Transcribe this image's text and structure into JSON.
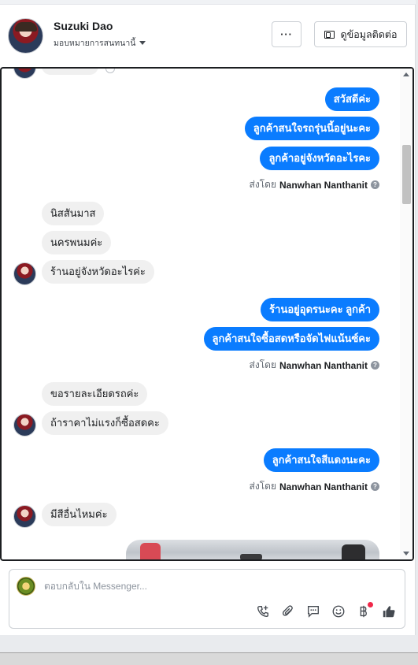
{
  "header": {
    "name": "Suzuki Dao",
    "assign_label": "มอบหมายการสนทนานี้",
    "more_label": "···",
    "contact_label": "ดูข้อมูลติดต่อ"
  },
  "messages": {
    "out1": [
      "สวัสดีค่ะ",
      "ลูกค้าสนใจรถรุ่นนี้อยู่นะคะ",
      "ลูกค้าอยู่จังหวัดอะไรคะ"
    ],
    "in1": [
      "นิสสันมาส",
      "นครพนมค่ะ",
      "ร้านอยู่จังหวัดอะไรค่ะ"
    ],
    "out2": [
      "ร้านอยู่อุดรนะคะ ลูกค้า",
      "ลูกค้าสนใจซื้อสดหรือจัดไฟแน้นซ์คะ"
    ],
    "in2": [
      "ขอรายละเอียดรถค่ะ",
      "ถ้าราคาไม่แรงก็ซื้อสดคะ"
    ],
    "out3": [
      "ลูกค้าสนใจสีแดงนะคะ"
    ],
    "in3": [
      "มีสีอื่นไหมค่ะ"
    ]
  },
  "sent_by": {
    "prefix": "ส่งโดย",
    "agent": "Nanwhan Nanthanit",
    "info_icon": "?"
  },
  "composer": {
    "placeholder": "ตอบกลับใน Messenger...",
    "tools": [
      "call-add-icon",
      "paperclip-icon",
      "saved-replies-icon",
      "emoji-icon",
      "baht-icon",
      "thumbs-up-icon"
    ]
  },
  "colors": {
    "outgoing_bubble": "#0a7cff",
    "incoming_bubble": "#f0f0f0"
  }
}
